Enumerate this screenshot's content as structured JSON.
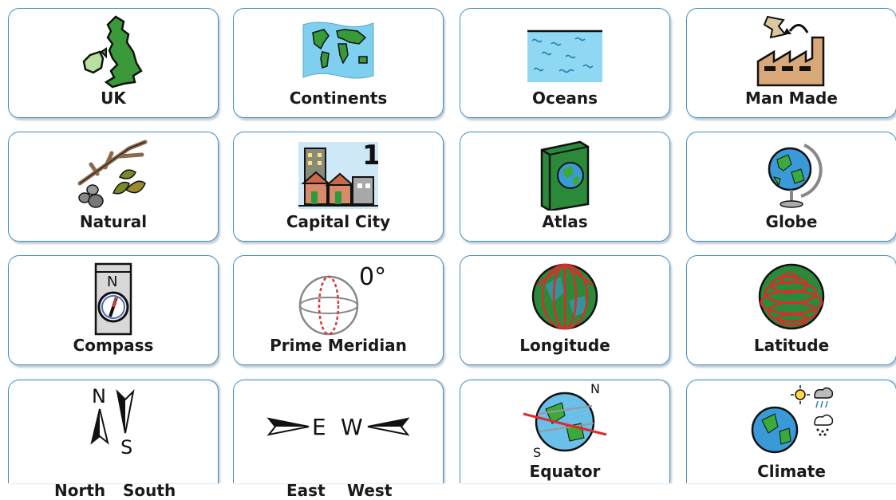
{
  "cards": [
    {
      "label": "UK",
      "icon": "uk-map-icon"
    },
    {
      "label": "Continents",
      "icon": "world-map-icon"
    },
    {
      "label": "Oceans",
      "icon": "ocean-icon"
    },
    {
      "label": "Man Made",
      "icon": "factory-icon"
    },
    {
      "label": "Natural",
      "icon": "natural-materials-icon"
    },
    {
      "label": "Capital City",
      "icon": "city-icon"
    },
    {
      "label": "Atlas",
      "icon": "atlas-book-icon"
    },
    {
      "label": "Globe",
      "icon": "globe-icon"
    },
    {
      "label": "Compass",
      "icon": "compass-icon"
    },
    {
      "label": "Prime Meridian",
      "icon": "prime-meridian-icon"
    },
    {
      "label": "Longitude",
      "icon": "longitude-icon"
    },
    {
      "label": "Latitude",
      "icon": "latitude-icon"
    },
    {
      "label_left": "North",
      "label_right": "South",
      "icon": "north-south-arrows-icon"
    },
    {
      "label_left": "East",
      "label_right": "West",
      "icon": "east-west-arrows-icon"
    },
    {
      "label": "Equator",
      "icon": "equator-icon"
    },
    {
      "label": "Climate",
      "icon": "climate-icon"
    }
  ],
  "icon_text": {
    "capital_number": "1",
    "degree": "0°",
    "compass_n": "N",
    "north_n": "N",
    "south_s": "S",
    "east_e": "E",
    "west_w": "W",
    "equator_n": "N",
    "equator_s": "S"
  },
  "colors": {
    "card_border": "#3f8fc6",
    "land_green": "#3a9a3a",
    "sea_blue": "#7fd0f0"
  }
}
